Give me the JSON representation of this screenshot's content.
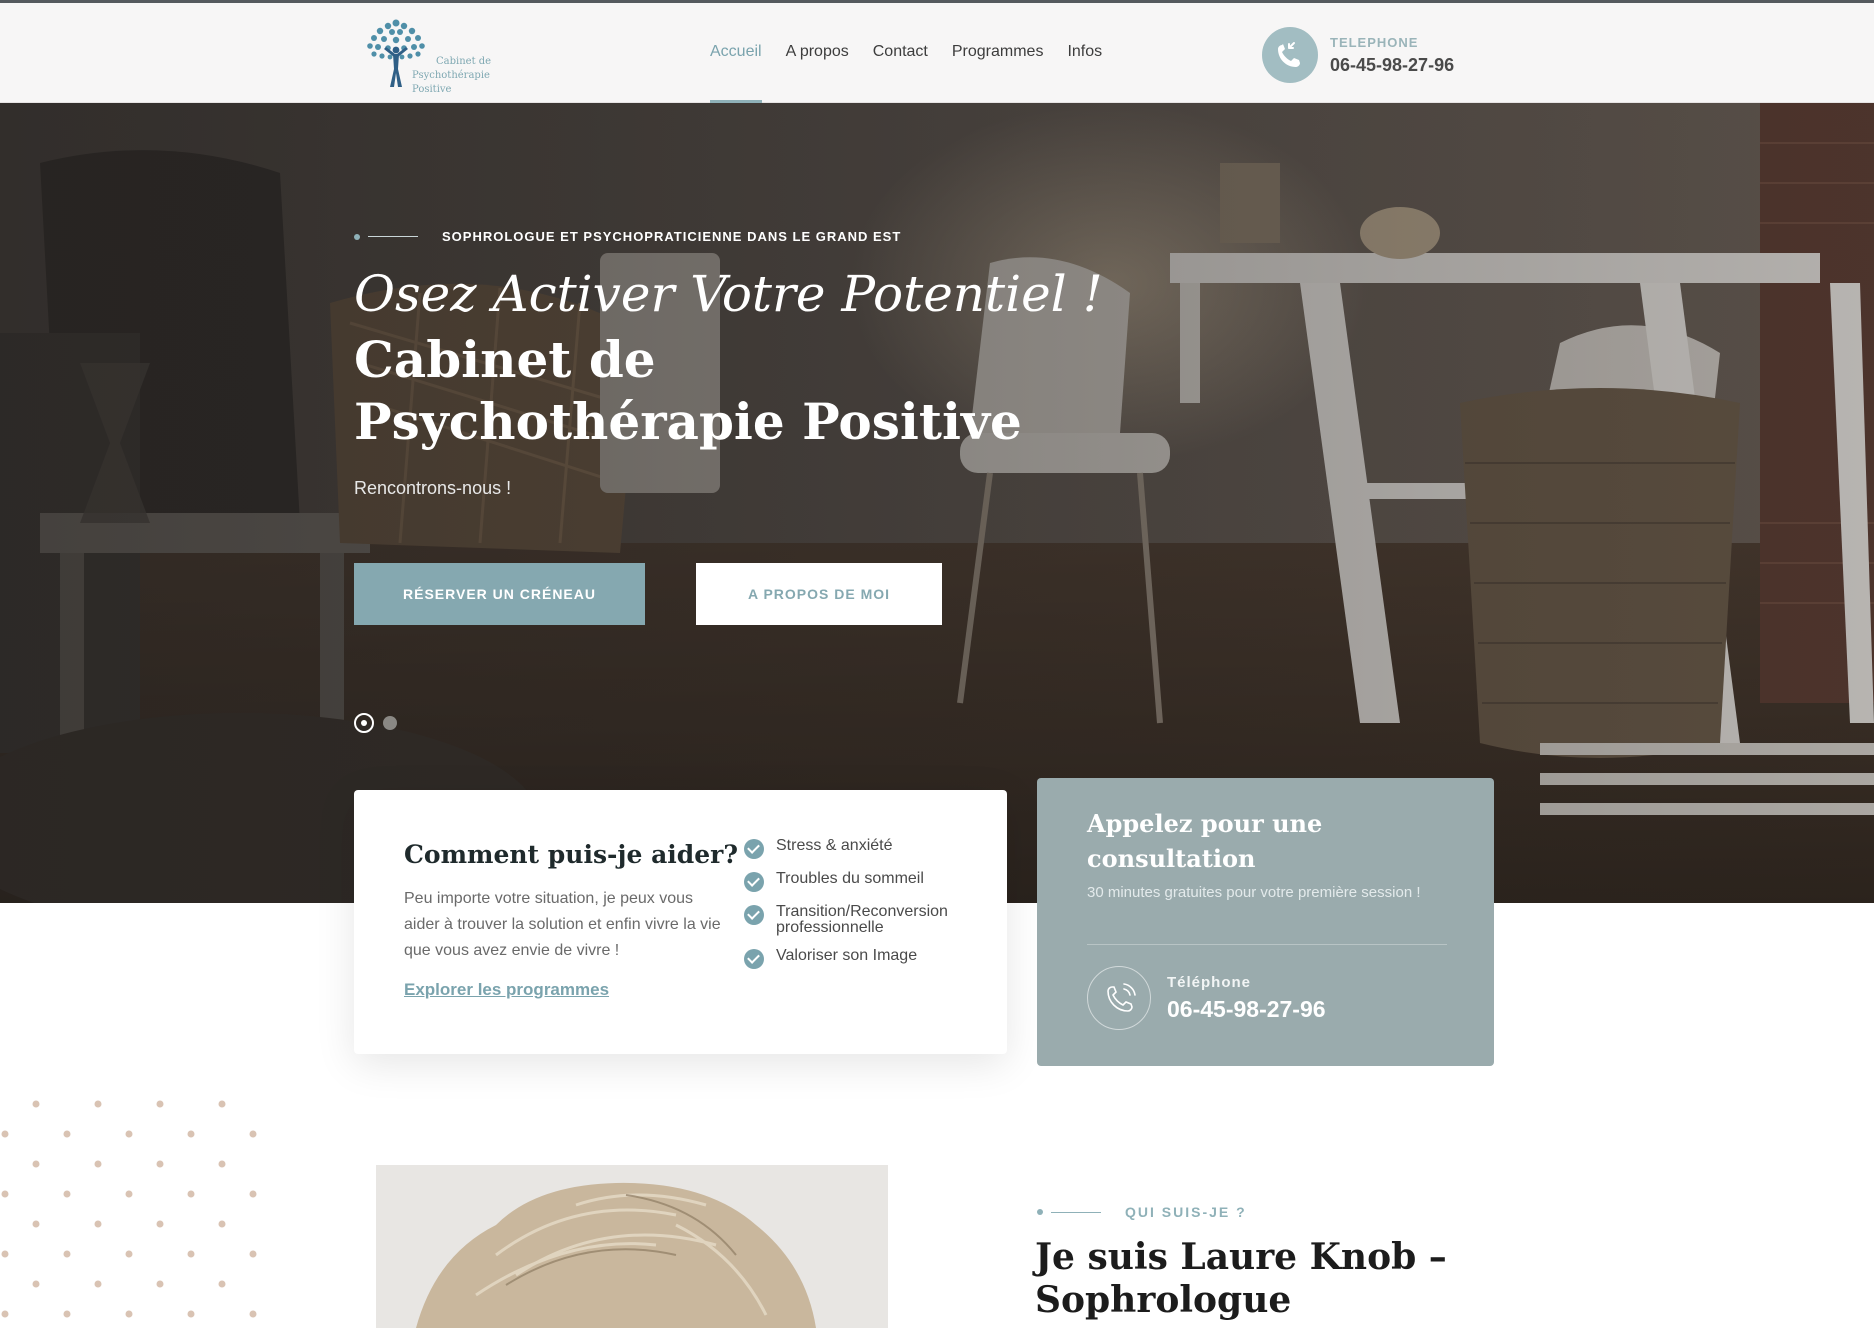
{
  "header": {
    "logo": {
      "line1": "Cabinet de",
      "line2": "Psychothérapie Positive"
    },
    "nav": [
      "Accueil",
      "A propos",
      "Contact",
      "Programmes",
      "Infos"
    ],
    "active_nav": "Accueil",
    "phone": {
      "label": "TELEPHONE",
      "number": "06-45-98-27-96",
      "icon": "phone-incoming-icon"
    }
  },
  "hero": {
    "eyebrow": "SOPHROLOGUE ET PSYCHOPRATICIENNE DANS LE GRAND EST",
    "italic_title": "Osez Activer Votre Potentiel !",
    "title": "Cabinet de Psychothérapie Positive",
    "subtitle": "Rencontrons-nous !",
    "primary_button": "RÉSERVER UN CRÉNEAU",
    "secondary_button": "A PROPOS DE MOI"
  },
  "help_card": {
    "title": "Comment puis-je aider?",
    "text": "Peu importe votre situation, je peux vous aider à trouver la solution et enfin vivre la vie que vous avez envie de vivre !",
    "link": "Explorer les programmes",
    "items": [
      "Stress & anxiété",
      "Troubles du sommeil",
      "Transition/Reconversion professionnelle",
      "Valoriser son Image"
    ]
  },
  "call_card": {
    "title": "Appelez pour une consultation",
    "subtitle": "30 minutes gratuites pour votre première session !",
    "phone_label": "Téléphone",
    "phone_number": "06-45-98-27-96"
  },
  "about": {
    "eyebrow": "QUI SUIS-JE ?",
    "title": "Je suis Laure Knob – Sophrologue"
  },
  "colors": {
    "accent": "#85a8b0",
    "call_card_bg": "#9aabad",
    "dots": "#d9c3b3"
  }
}
